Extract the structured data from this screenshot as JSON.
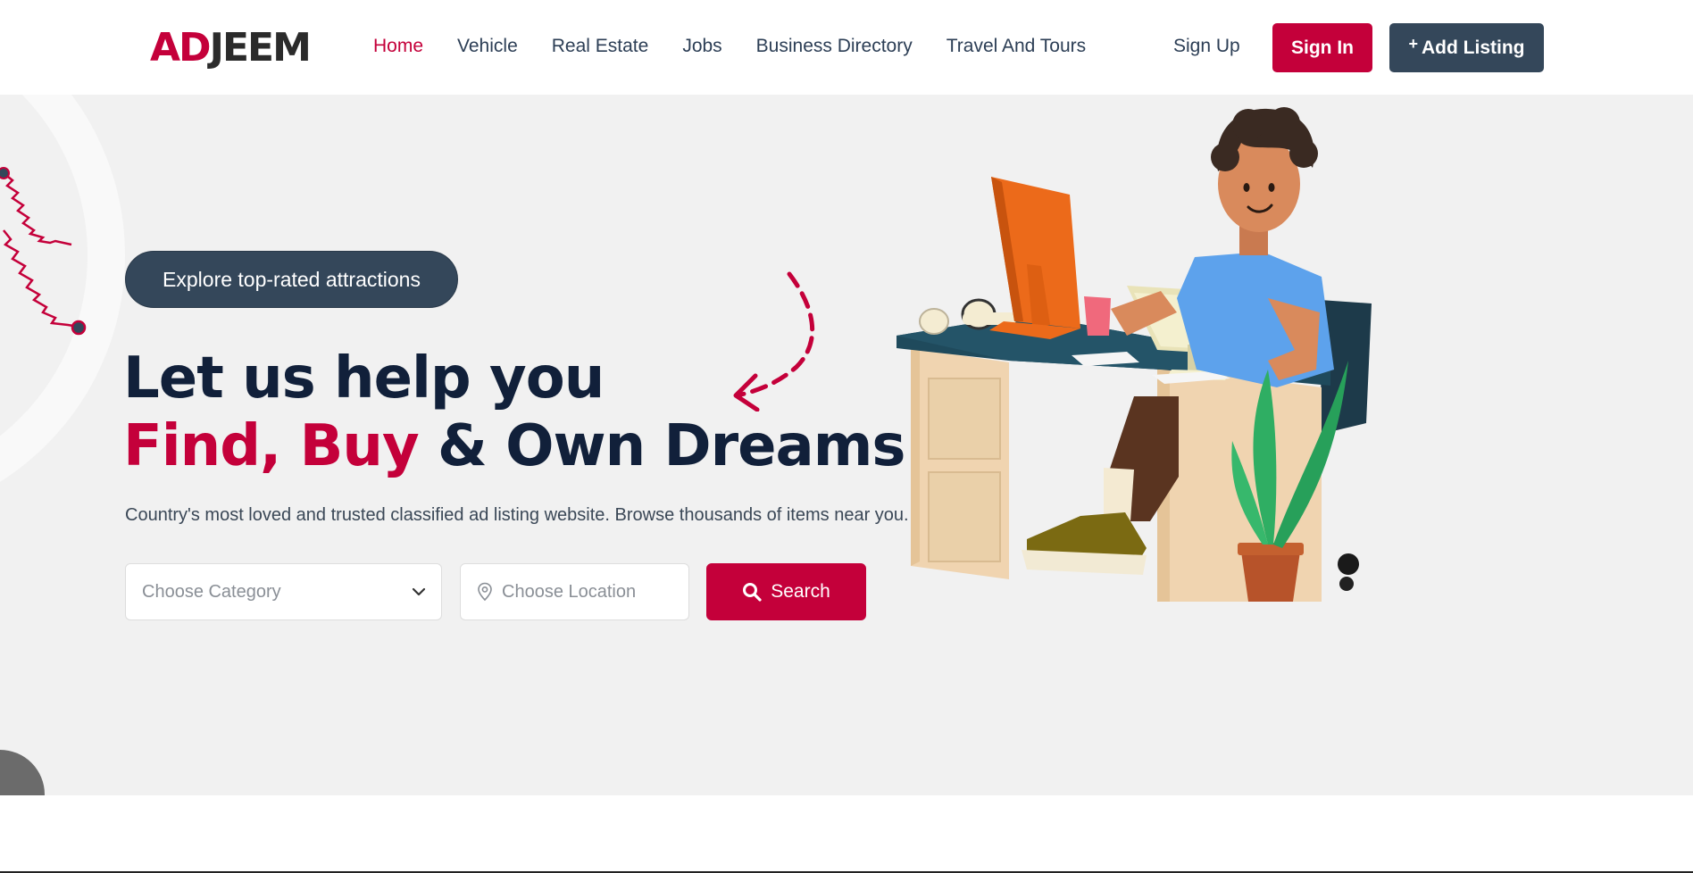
{
  "brand": {
    "logo_ad": "AD",
    "logo_jeem": "JEEM",
    "accent": "#c4003a",
    "dark": "#34475a"
  },
  "nav": {
    "items": [
      {
        "label": "Home",
        "active": true
      },
      {
        "label": "Vehicle",
        "active": false
      },
      {
        "label": "Real Estate",
        "active": false
      },
      {
        "label": "Jobs",
        "active": false
      },
      {
        "label": "Business Directory",
        "active": false
      },
      {
        "label": "Travel And Tours",
        "active": false
      }
    ],
    "signup_label": "Sign Up",
    "signin_label": "Sign In",
    "add_listing_plus": "+",
    "add_listing_label": "Add Listing"
  },
  "hero": {
    "pill_label": "Explore top-rated attractions",
    "headline_line1": "Let us help you",
    "headline_find": "Find,",
    "headline_buy": "Buy",
    "headline_rest": "& Own Dreams",
    "subtext": "Country's most loved and trusted classified ad listing website. Browse thousands of items near you."
  },
  "search": {
    "category_placeholder": "Choose Category",
    "location_placeholder": "Choose Location",
    "button_label": "Search"
  },
  "icons": {
    "category_chevron": "chevron-down-icon",
    "location": "map-pin-icon",
    "search": "search-icon"
  }
}
